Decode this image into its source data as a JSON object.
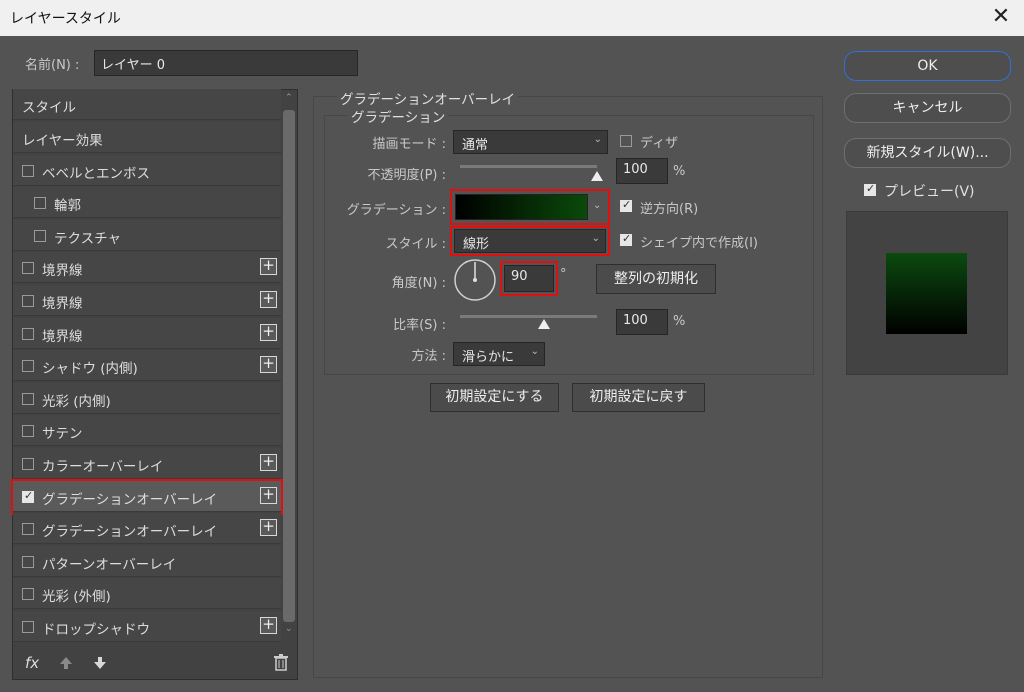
{
  "window": {
    "title": "レイヤースタイル",
    "close": "✕"
  },
  "name_field": {
    "label": "名前(N) :",
    "value": "レイヤー 0"
  },
  "layer_list": {
    "header": "スタイル",
    "items": [
      {
        "label": "レイヤー効果",
        "checkbox": false,
        "has_checkbox": false,
        "plus": false
      },
      {
        "label": "ベベルとエンボス",
        "checkbox": false,
        "has_checkbox": true,
        "plus": false
      },
      {
        "label": "輪郭",
        "checkbox": false,
        "has_checkbox": true,
        "plus": false,
        "indent": true
      },
      {
        "label": "テクスチャ",
        "checkbox": false,
        "has_checkbox": true,
        "plus": false,
        "indent": true
      },
      {
        "label": "境界線",
        "checkbox": false,
        "has_checkbox": true,
        "plus": true
      },
      {
        "label": "境界線",
        "checkbox": false,
        "has_checkbox": true,
        "plus": true
      },
      {
        "label": "境界線",
        "checkbox": false,
        "has_checkbox": true,
        "plus": true
      },
      {
        "label": "シャドウ (内側)",
        "checkbox": false,
        "has_checkbox": true,
        "plus": true
      },
      {
        "label": "光彩 (内側)",
        "checkbox": false,
        "has_checkbox": true,
        "plus": false
      },
      {
        "label": "サテン",
        "checkbox": false,
        "has_checkbox": true,
        "plus": false
      },
      {
        "label": "カラーオーバーレイ",
        "checkbox": false,
        "has_checkbox": true,
        "plus": true
      },
      {
        "label": "グラデーションオーバーレイ",
        "checkbox": true,
        "has_checkbox": true,
        "plus": true,
        "selected": true
      },
      {
        "label": "グラデーションオーバーレイ",
        "checkbox": false,
        "has_checkbox": true,
        "plus": true
      },
      {
        "label": "パターンオーバーレイ",
        "checkbox": false,
        "has_checkbox": true,
        "plus": false
      },
      {
        "label": "光彩 (外側)",
        "checkbox": false,
        "has_checkbox": true,
        "plus": false
      },
      {
        "label": "ドロップシャドウ",
        "checkbox": false,
        "has_checkbox": true,
        "plus": true
      }
    ],
    "footer": {
      "fx": "fx",
      "up_icon": "arrow-up-icon",
      "down_icon": "arrow-down-icon",
      "trash_icon": "trash-icon"
    }
  },
  "panel": {
    "title": "グラデーションオーバーレイ",
    "subtitle": "グラデーション",
    "blend_mode": {
      "label": "描画モード :",
      "value": "通常"
    },
    "dither": {
      "label": "ディザ",
      "checked": false
    },
    "opacity": {
      "label": "不透明度(P) :",
      "value": "100",
      "unit": "%",
      "level": 1.0
    },
    "gradient": {
      "label": "グラデーション :",
      "from": "#000000",
      "to": "#0a4a0a"
    },
    "reverse": {
      "label": "逆方向(R)",
      "checked": true
    },
    "style": {
      "label": "スタイル :",
      "value": "線形"
    },
    "align": {
      "label": "シェイプ内で作成(I)",
      "checked": true
    },
    "angle": {
      "label": "角度(N) :",
      "value": "90",
      "unit": "°"
    },
    "reset_alignment": "整列の初期化",
    "scale": {
      "label": "比率(S) :",
      "value": "100",
      "unit": "%",
      "level": 0.61
    },
    "method": {
      "label": "方法 :",
      "value": "滑らかに"
    },
    "make_default": "初期設定にする",
    "reset_default": "初期設定に戻す"
  },
  "right": {
    "ok": "OK",
    "cancel": "キャンセル",
    "new_style": "新規スタイル(W)...",
    "preview": {
      "label": "プレビュー(V)",
      "checked": true
    },
    "preview_colors": {
      "top": "#0b4a0f",
      "bottom": "#000000"
    }
  },
  "colors": {
    "highlight": "#e01010",
    "accent_blue": "#2f6fd6"
  }
}
